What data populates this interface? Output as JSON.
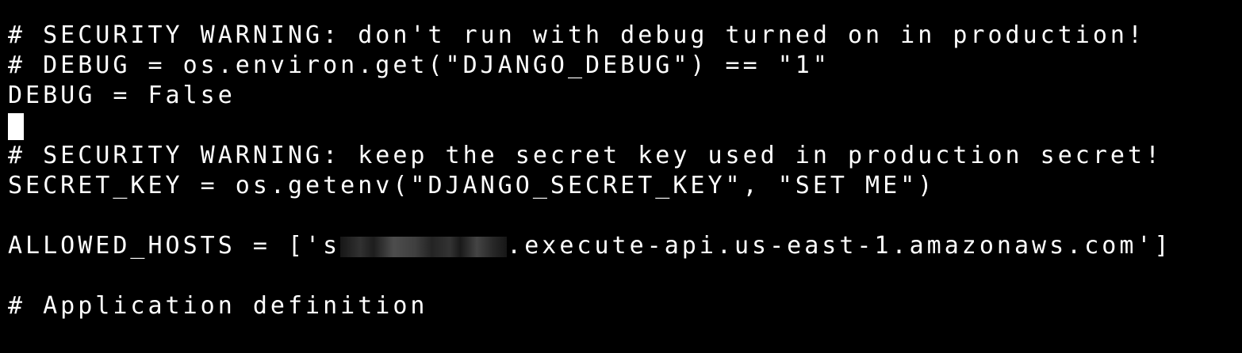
{
  "terminal": {
    "background": "#000000",
    "foreground": "#ffffff",
    "lines": [
      "# SECURITY WARNING: don't run with debug turned on in production!",
      "# DEBUG = os.environ.get(\"DJANGO_DEBUG\") == \"1\"",
      "DEBUG = False",
      "",
      "# SECURITY WARNING: keep the secret key used in production secret!",
      "SECRET_KEY = os.getenv(\"DJANGO_SECRET_KEY\", \"SET ME\")",
      "",
      "",
      "",
      "# Application definition"
    ],
    "allowed_hosts": {
      "prefix": "ALLOWED_HOSTS = ['s",
      "suffix": ".execute-api.us-east-1.amazonaws.com']"
    }
  }
}
